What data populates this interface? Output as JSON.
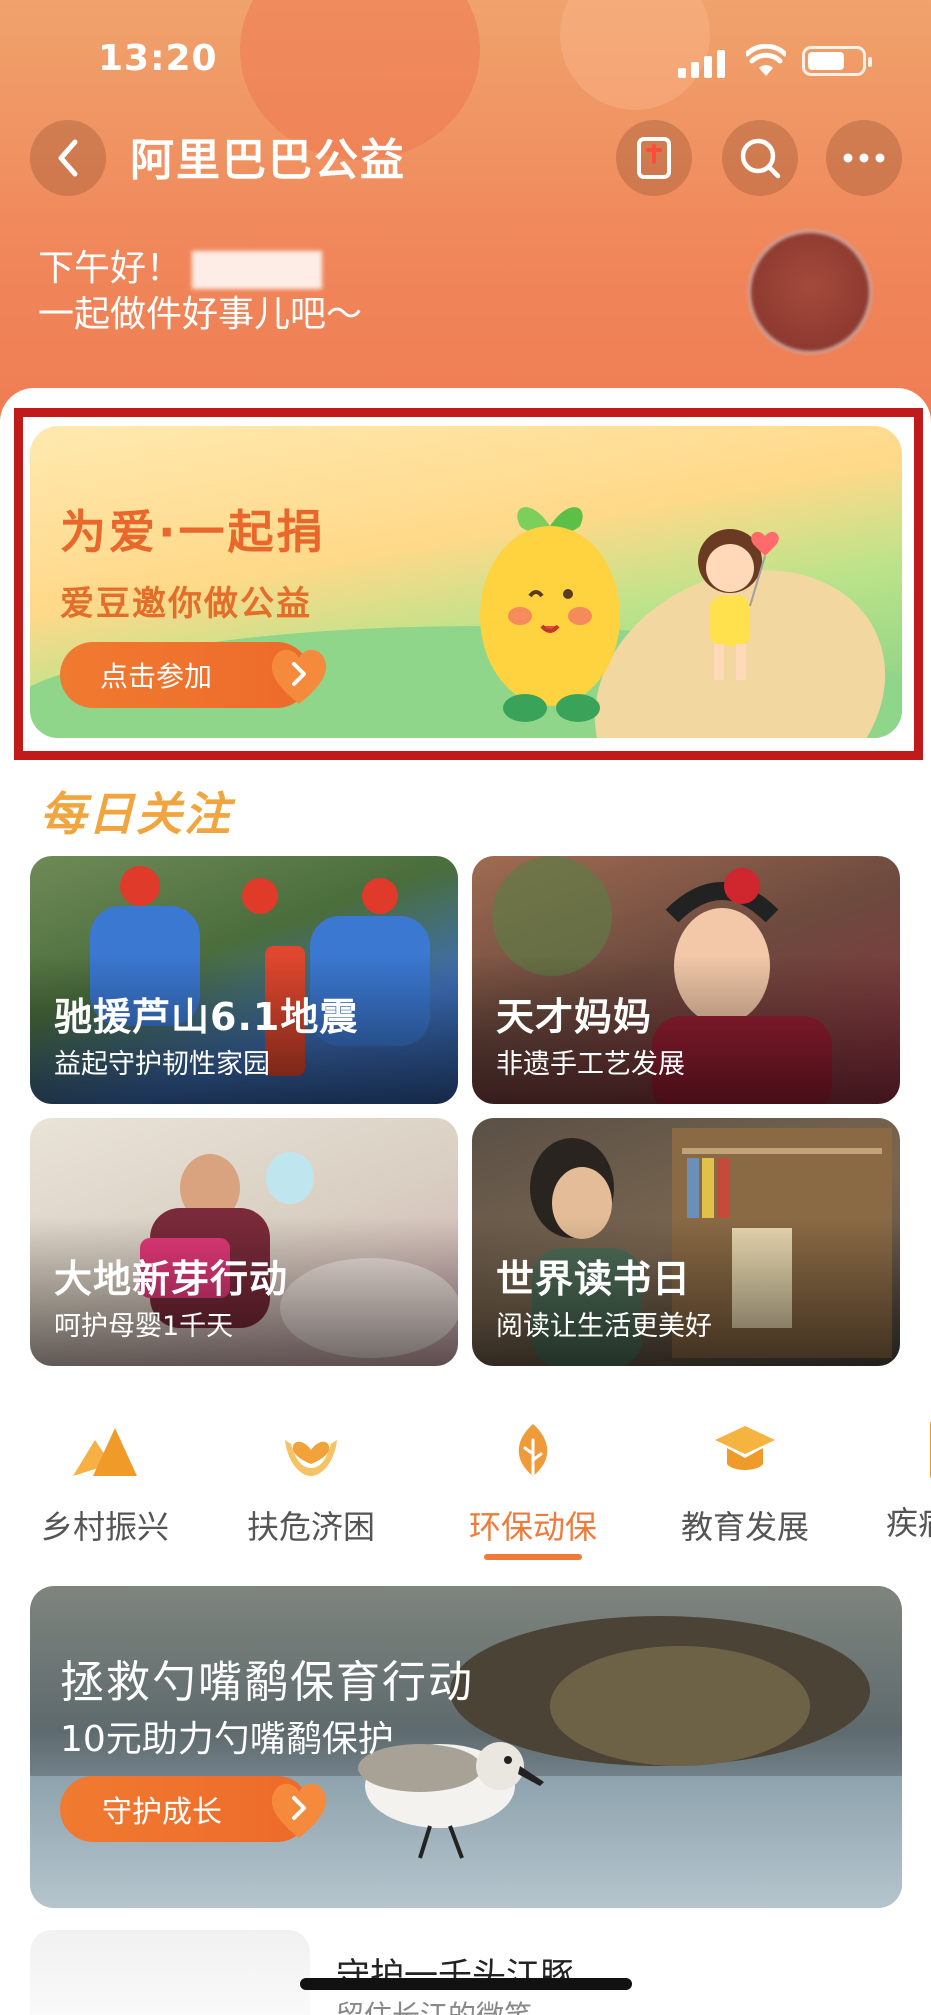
{
  "status_bar": {
    "time": "13:20"
  },
  "nav": {
    "title": "阿里巴巴公益"
  },
  "greeting": {
    "line1": "下午好！",
    "line2": "一起做件好事儿吧～"
  },
  "hero": {
    "title": "为爱·一起捐",
    "subtitle": "爱豆邀你做公益",
    "button": "点击参加"
  },
  "daily": {
    "title": "每日关注",
    "cards": [
      {
        "title": "驰援芦山6.1地震",
        "subtitle": "益起守护韧性家园"
      },
      {
        "title": "天才妈妈",
        "subtitle": "非遗手工艺发展"
      },
      {
        "title": "大地新芽行动",
        "subtitle": "呵护母婴1千天"
      },
      {
        "title": "世界读书日",
        "subtitle": "阅读让生活更美好"
      }
    ]
  },
  "categories": {
    "items": [
      {
        "label": "乡村振兴",
        "icon": "mountain-icon"
      },
      {
        "label": "扶危济困",
        "icon": "heart-hands-icon"
      },
      {
        "label": "环保动保",
        "icon": "leaf-icon"
      },
      {
        "label": "教育发展",
        "icon": "graduation-cap-icon"
      },
      {
        "label": "疾病",
        "icon": ""
      }
    ],
    "active_index": 2
  },
  "feature": {
    "title": "拯救勺嘴鹬保育行动",
    "subtitle": "10元助力勺嘴鹬保护",
    "button": "守护成长"
  },
  "next_item": {
    "title": "守护一千头江豚",
    "subtitle": "留住长江的微笑"
  },
  "colors": {
    "accent": "#ef7a3a",
    "header": "#f0865a",
    "highlight_frame": "#c01a1a"
  }
}
